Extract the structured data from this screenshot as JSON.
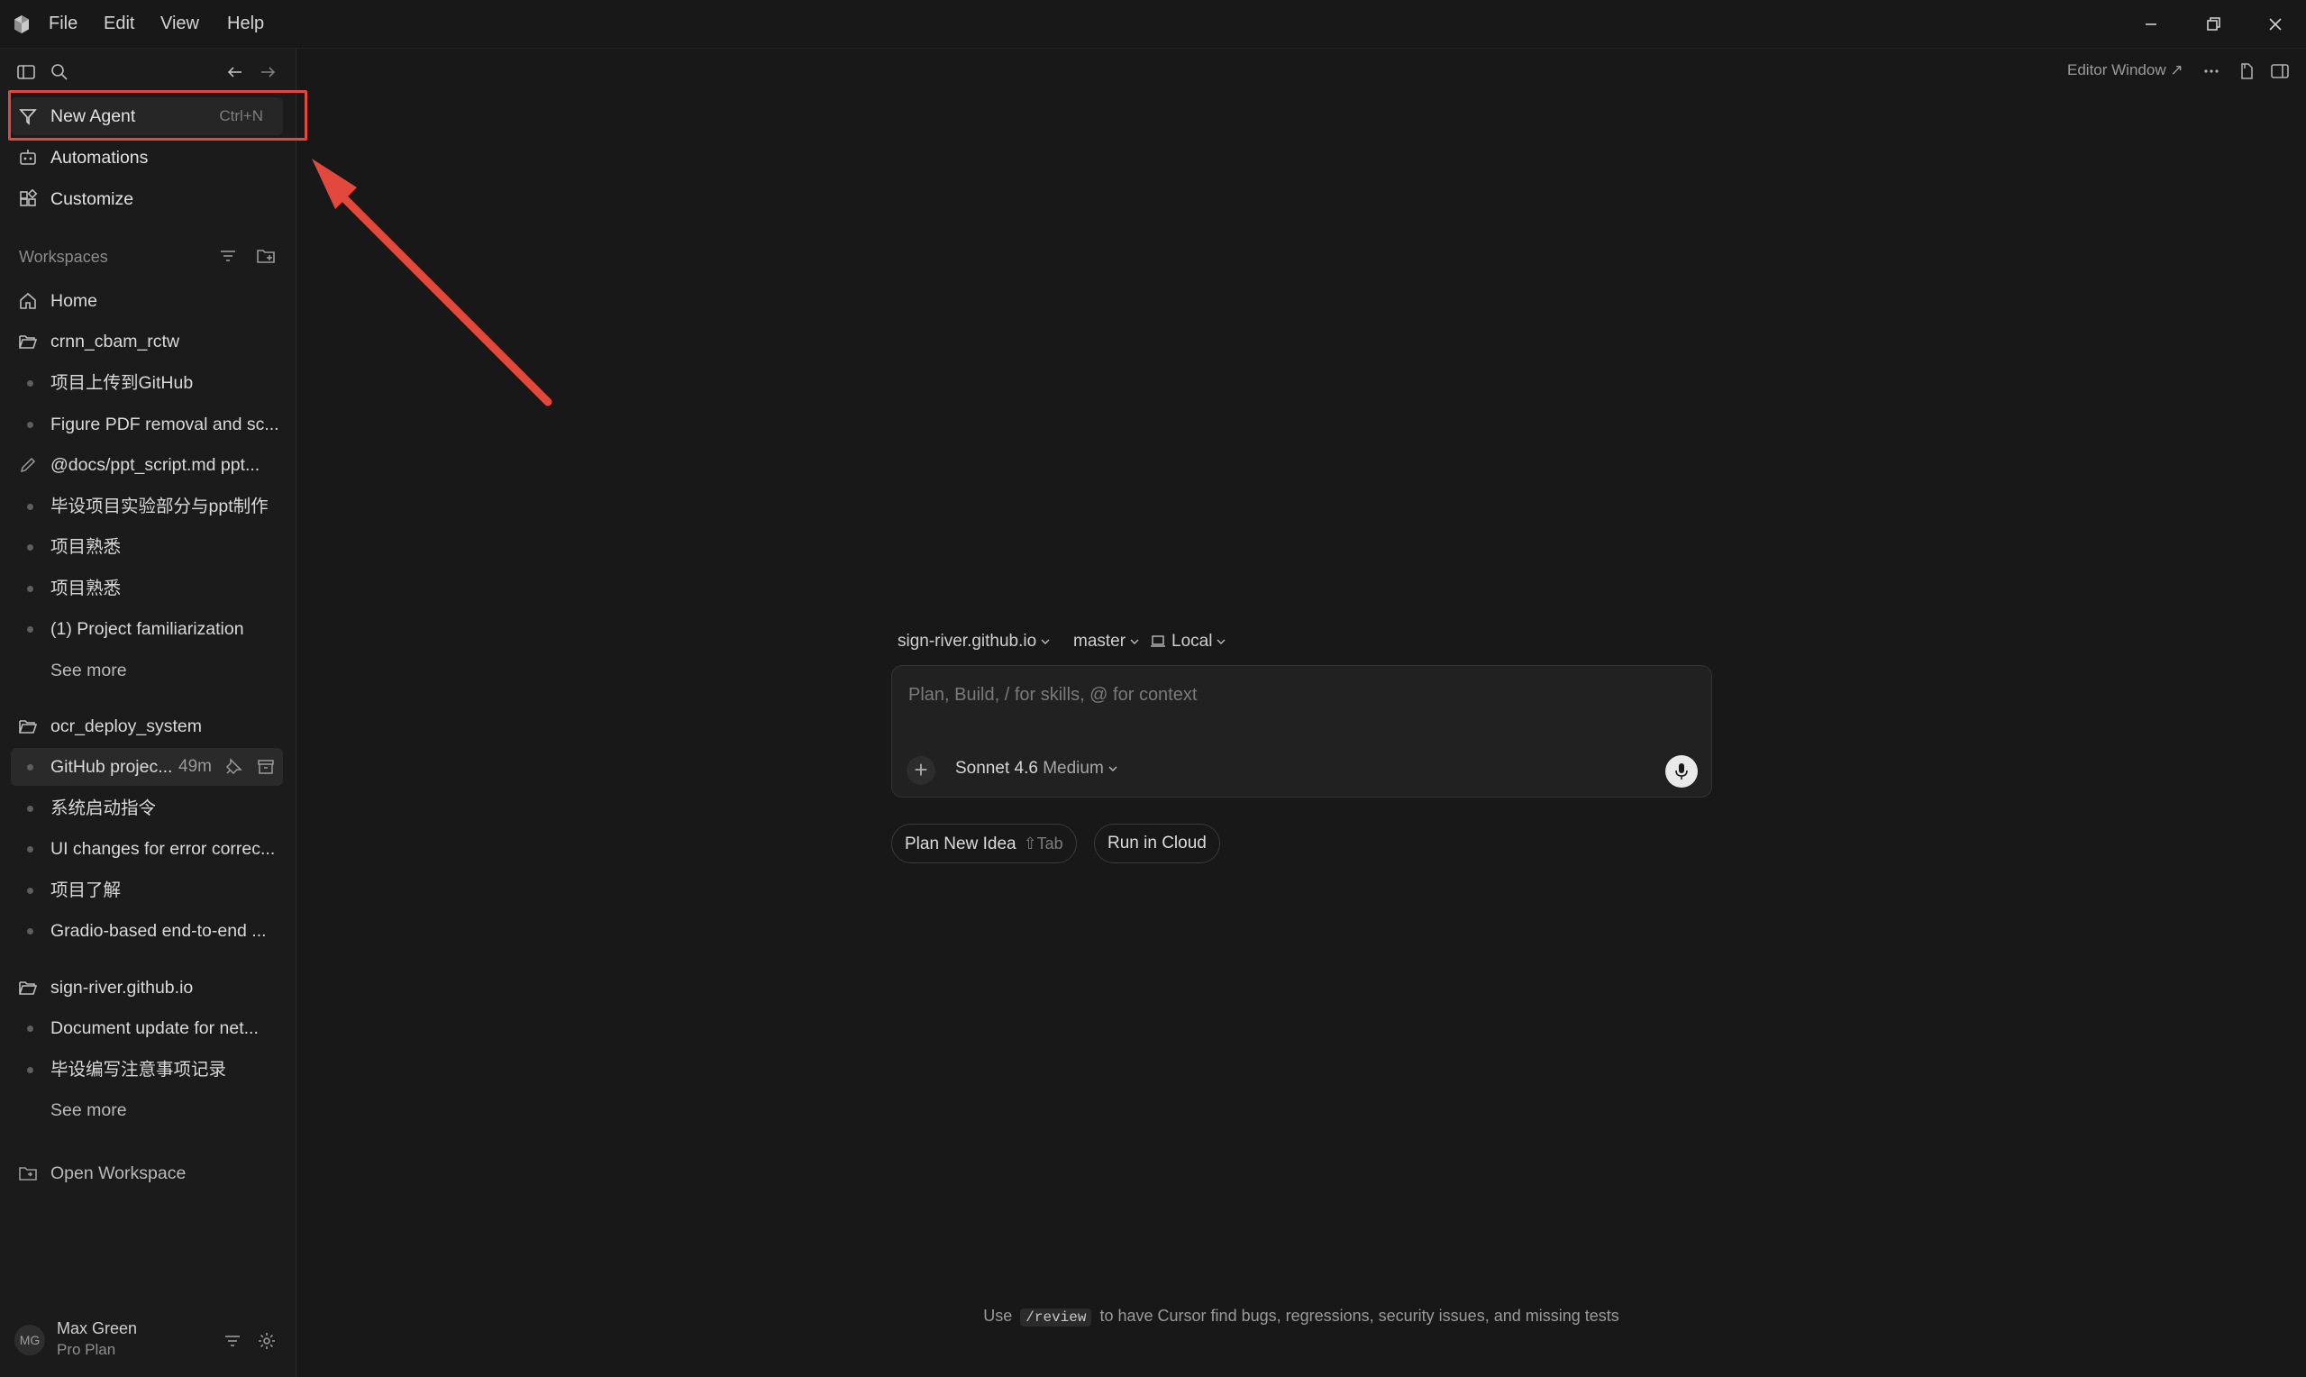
{
  "menubar": {
    "items": [
      "File",
      "Edit",
      "View",
      "Help"
    ]
  },
  "sidebar": {
    "primary": [
      {
        "label": "New Agent",
        "shortcut": "Ctrl+N",
        "icon": "new-agent-icon"
      },
      {
        "label": "Automations",
        "icon": "automations-icon"
      },
      {
        "label": "Customize",
        "icon": "customize-icon"
      }
    ],
    "workspaces_label": "Workspaces",
    "home_label": "Home",
    "groups": [
      {
        "name": "crnn_cbam_rctw",
        "items": [
          "项目上传到GitHub",
          "Figure PDF removal and sc...",
          "@docs/ppt_script.md ppt...",
          "毕设项目实验部分与ppt制作",
          "项目熟悉",
          "项目熟悉",
          "(1) Project familiarization"
        ],
        "see_more": "See more"
      },
      {
        "name": "ocr_deploy_system",
        "active_item": {
          "label": "GitHub projec...",
          "age": "49m"
        },
        "items": [
          "系统启动指令",
          "UI changes for error correc...",
          "项目了解",
          "Gradio-based end-to-end ..."
        ]
      },
      {
        "name": "sign-river.github.io",
        "items": [
          "Document update for net...",
          "毕设编写注意事项记录"
        ],
        "see_more": "See more"
      }
    ],
    "open_workspace": "Open Workspace",
    "user": {
      "initials": "MG",
      "name": "Max Green",
      "plan": "Pro Plan"
    }
  },
  "main": {
    "editor_window": "Editor Window ↗",
    "composer": {
      "repo": "sign-river.github.io",
      "branch": "master",
      "env": "Local",
      "placeholder": "Plan, Build, / for skills, @ for context",
      "value": "",
      "model": "Sonnet 4.6",
      "effort": "Medium"
    },
    "actions": {
      "plan_label": "Plan New Idea",
      "plan_kbd": "⇧Tab",
      "cloud_label": "Run in Cloud"
    },
    "tip": {
      "prefix": "Use",
      "code": "/review",
      "suffix": "to have Cursor find bugs, regressions, security issues, and missing tests"
    }
  },
  "colors": {
    "background": "#181818",
    "sidebar": "#1b1b1b",
    "highlight": "#e2483b",
    "active_row": "#2a2a2a"
  }
}
